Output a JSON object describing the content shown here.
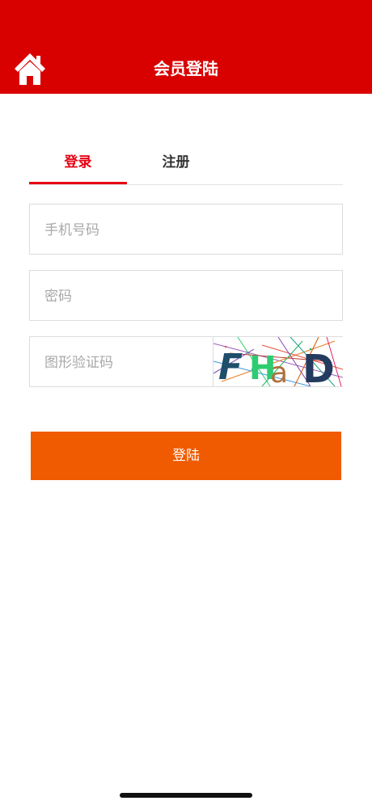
{
  "header": {
    "title": "会员登陆",
    "background": "#d90000",
    "home_icon": "home-icon"
  },
  "tabs": [
    {
      "label": "登录",
      "active": true
    },
    {
      "label": "注册",
      "active": false
    }
  ],
  "form": {
    "phone_placeholder": "手机号码",
    "password_placeholder": "密码",
    "captcha_placeholder": "图形验证码",
    "captcha_text": "FHaD",
    "submit_label": "登陆"
  },
  "colors": {
    "accent": "#e60012",
    "submit": "#f05a00"
  }
}
